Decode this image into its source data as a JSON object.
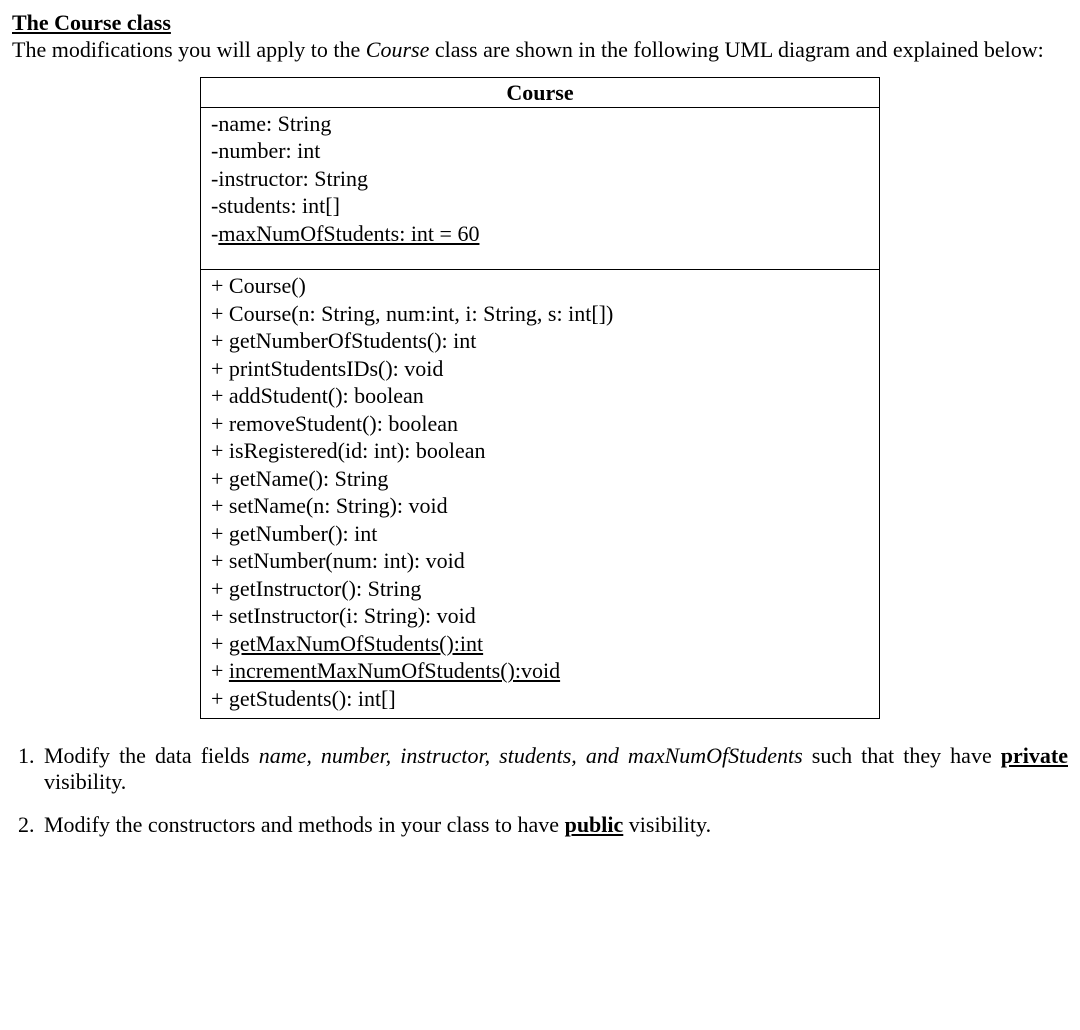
{
  "heading": "The Course class",
  "intro_pre": "The modifications you will apply to the ",
  "intro_course": "Course",
  "intro_post": " class are shown in the following UML diagram and explained below:",
  "uml": {
    "class_name": "Course",
    "attributes": [
      {
        "text": "-name: String",
        "underline": false
      },
      {
        "text": "-number: int",
        "underline": false
      },
      {
        "text": "-instructor: String",
        "underline": false
      },
      {
        "text": "-students: int[]",
        "underline": false
      },
      {
        "text": "-maxNumOfStudents: int = 60",
        "underline": true
      }
    ],
    "methods": [
      {
        "text": "+ Course()",
        "underline": false
      },
      {
        "text": "+ Course(n: String, num:int, i: String, s: int[])",
        "underline": false
      },
      {
        "text": "+ getNumberOfStudents(): int",
        "underline": false
      },
      {
        "text": "+ printStudentsIDs(): void",
        "underline": false
      },
      {
        "text": "+ addStudent(): boolean",
        "underline": false
      },
      {
        "text": "+ removeStudent(): boolean",
        "underline": false
      },
      {
        "text": "+ isRegistered(id: int): boolean",
        "underline": false
      },
      {
        "text": "+ getName(): String",
        "underline": false
      },
      {
        "text": "+ setName(n: String): void",
        "underline": false
      },
      {
        "text": "+ getNumber(): int",
        "underline": false
      },
      {
        "text": "+ setNumber(num: int): void",
        "underline": false
      },
      {
        "text": "+ getInstructor(): String",
        "underline": false
      },
      {
        "text": "+ setInstructor(i: String): void",
        "underline": false
      },
      {
        "prefix": "+ ",
        "underline_text": "getMaxNumOfStudents():int",
        "underline": true
      },
      {
        "prefix": "+ ",
        "underline_text": "incrementMaxNumOfStudents():void",
        "underline": true
      },
      {
        "text": "+ getStudents(): int[]",
        "underline": false
      }
    ]
  },
  "list": {
    "item1_pre": "Modify the data fields ",
    "item1_fields": "name, number, instructor, students, and maxNumOfStudents",
    "item1_mid": " such that they have ",
    "item1_bold": "private",
    "item1_post": " visibility.",
    "item2_pre": "Modify the constructors and methods in your class to have ",
    "item2_bold": "public",
    "item2_post": " visibility."
  }
}
